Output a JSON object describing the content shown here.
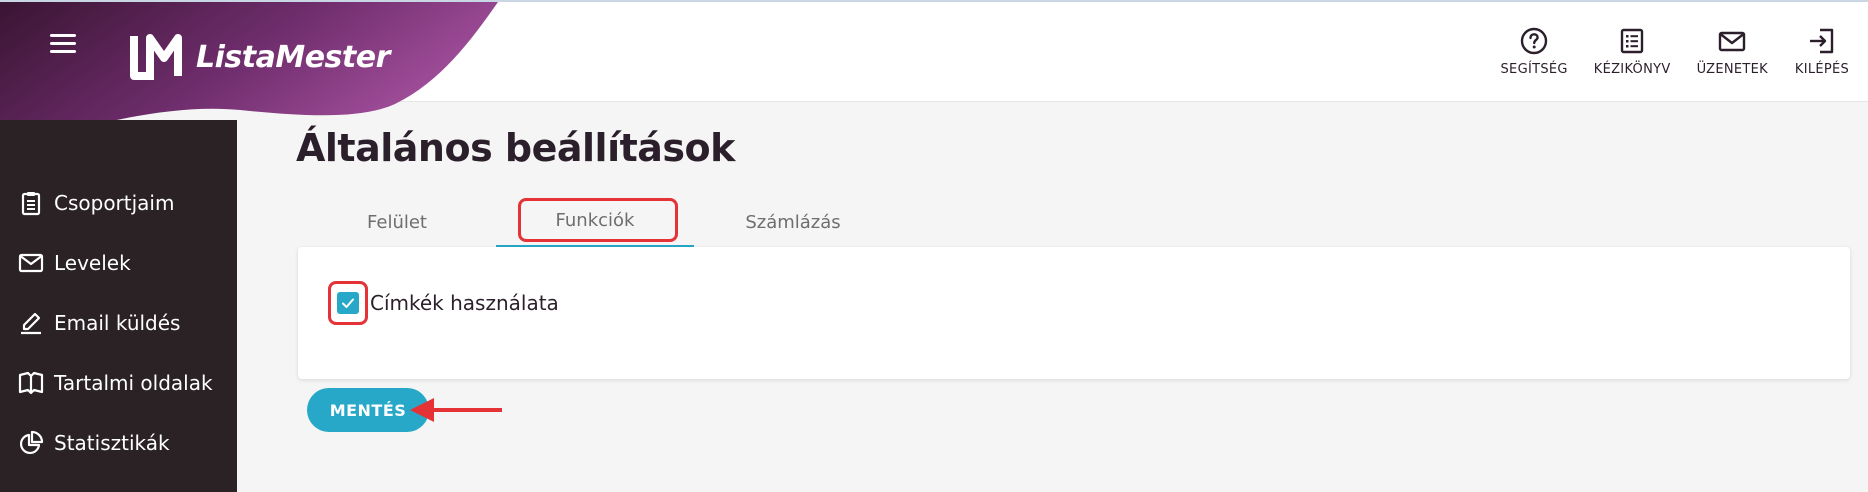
{
  "header": {
    "brand": "ListaMester",
    "actions": [
      {
        "label": "SEGÍTSÉG",
        "icon": "help-circle-icon"
      },
      {
        "label": "KÉZIKÖNYV",
        "icon": "book-list-icon"
      },
      {
        "label": "ÜZENETEK",
        "icon": "mail-icon"
      },
      {
        "label": "KILÉPÉS",
        "icon": "logout-icon"
      }
    ]
  },
  "sidebar": {
    "items": [
      {
        "label": "Csoportjaim",
        "icon": "clipboard-icon"
      },
      {
        "label": "Levelek",
        "icon": "envelope-icon"
      },
      {
        "label": "Email küldés",
        "icon": "pen-icon"
      },
      {
        "label": "Tartalmi oldalak",
        "icon": "open-book-icon"
      },
      {
        "label": "Statisztikák",
        "icon": "pie-chart-icon"
      }
    ]
  },
  "main": {
    "title": "Általános beállítások",
    "tabs": [
      {
        "label": "Felület",
        "active": false
      },
      {
        "label": "Funkciók",
        "active": true
      },
      {
        "label": "Számlázás",
        "active": false
      }
    ],
    "checkbox": {
      "label": "Címkék használata",
      "checked": true
    },
    "save_label": "MENTÉS"
  },
  "colors": {
    "accent": "#27a8c8",
    "sidebar_bg": "#2a2225",
    "brand_purple": "#7a3a82",
    "highlight": "#e53236"
  }
}
